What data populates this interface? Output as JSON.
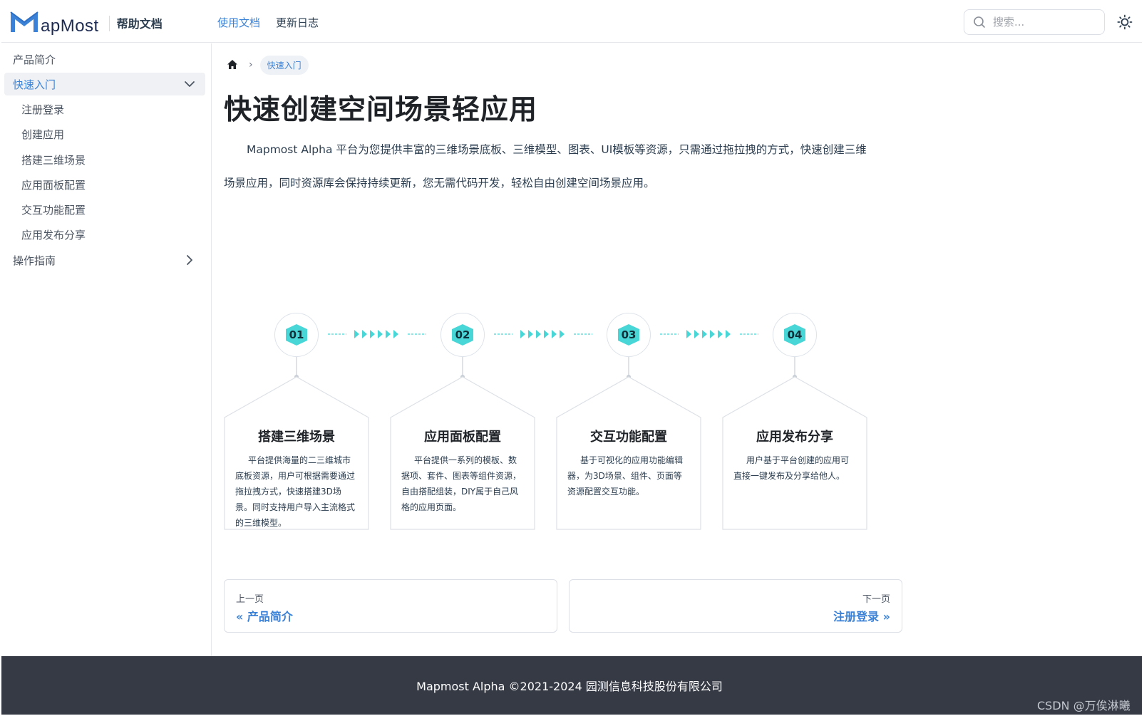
{
  "header": {
    "logo_text": "apMost",
    "site_name": "帮助文档",
    "nav": [
      {
        "label": "使用文档",
        "active": true
      },
      {
        "label": "更新日志",
        "active": false
      }
    ],
    "search_placeholder": "搜索...",
    "theme_icon": "sun-icon"
  },
  "sidebar": {
    "items": [
      {
        "label": "产品简介",
        "level": 1,
        "active": false
      },
      {
        "label": "快速入门",
        "level": 1,
        "active": true,
        "expanded": true
      },
      {
        "label": "注册登录",
        "level": 2
      },
      {
        "label": "创建应用",
        "level": 2
      },
      {
        "label": "搭建三维场景",
        "level": 2
      },
      {
        "label": "应用面板配置",
        "level": 2
      },
      {
        "label": "交互功能配置",
        "level": 2
      },
      {
        "label": "应用发布分享",
        "level": 2
      },
      {
        "label": "操作指南",
        "level": 1,
        "expanded": false
      }
    ]
  },
  "breadcrumb": {
    "current": "快速入门"
  },
  "main": {
    "title": "快速创建空间场景轻应用",
    "intro": "Mapmost Alpha 平台为您提供丰富的三维场景底板、三维模型、图表、UI模板等资源，只需通过拖拉拽的方式，快速创建三维场景应用，同时资源库会保持持续更新，您无需代码开发，轻松自由创建空间场景应用。"
  },
  "steps": [
    {
      "num": "01",
      "title": "搭建三维场景",
      "text": "平台提供海量的二三维城市底板资源，用户可根据需要通过拖拉拽方式，快速搭建3D场景。同时支持用户导入主流格式的三维模型。"
    },
    {
      "num": "02",
      "title": "应用面板配置",
      "text": "平台提供一系列的模板、数据项、套件、图表等组件资源，自由搭配组装，DIY属于自己风格的应用页面。"
    },
    {
      "num": "03",
      "title": "交互功能配置",
      "text": "基于可视化的应用功能编辑器，为3D场景、组件、页面等资源配置交互功能。"
    },
    {
      "num": "04",
      "title": "应用发布分享",
      "text": "用户基于平台创建的应用可直接一键发布及分享给他人。"
    }
  ],
  "pager": {
    "prev_label": "上一页",
    "prev_link": "« 产品简介",
    "next_label": "下一页",
    "next_link": "注册登录 »"
  },
  "footer": {
    "text": "Mapmost Alpha ©2021-2024 园测信息科技股份有限公司"
  },
  "watermark": "CSDN @万俟淋曦",
  "colors": {
    "accent": "#3b82d7",
    "teal": "#49d6d6",
    "footer_bg": "#353a45"
  }
}
